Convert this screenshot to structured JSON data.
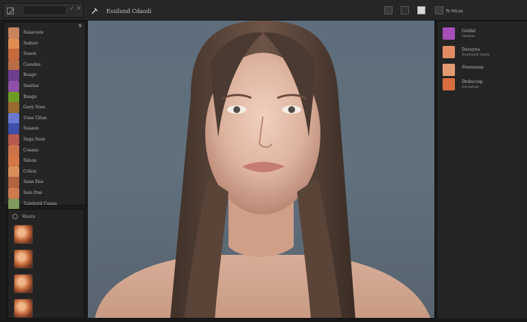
{
  "window": {
    "title": "Essilund Cdaodi"
  },
  "topbar": {
    "app_icon": "wrench-icon",
    "check_icon": "check-icon",
    "close_icon": "close-icon",
    "tool_icon": "hammer-icon",
    "right_label": "fb Ntcas",
    "buttons": [
      "camera-icon",
      "layout-icon",
      "render-icon",
      "settings-icon"
    ]
  },
  "left_panel": {
    "count": "9",
    "items": [
      {
        "label": "Saaacoon",
        "color": "#c9845d"
      },
      {
        "label": "Soduvr",
        "color": "#dd8d50"
      },
      {
        "label": "Suacn",
        "color": "#c66a3d"
      },
      {
        "label": "Csosdos",
        "color": "#bb6d45"
      },
      {
        "label": "Buagv",
        "color": "#6e3d90"
      },
      {
        "label": "Sanitas",
        "color": "#8f4ea8"
      },
      {
        "label": "Buagn",
        "color": "#6e9b25"
      },
      {
        "label": "Gaoy Sosa",
        "color": "#9a6a2f"
      },
      {
        "label": "Usne Citan",
        "color": "#6a7ad0"
      },
      {
        "label": "Saaaon",
        "color": "#3e4ea9"
      },
      {
        "label": "Saga Sosn",
        "color": "#b85a4d"
      },
      {
        "label": "Cosano",
        "color": "#cc7248"
      },
      {
        "label": "Siman",
        "color": "#d57645"
      },
      {
        "label": "Cvlicn",
        "color": "#d98f5a"
      },
      {
        "label": "Sann Ena",
        "color": "#b06440"
      },
      {
        "label": "Sain Itna",
        "color": "#d07b4f"
      },
      {
        "label": "Tuinhntd Cuana",
        "color": "#7f9a5a"
      }
    ]
  },
  "left_lower": {
    "title": "Wantu",
    "swatches": 4
  },
  "right_panel": {
    "items": [
      {
        "label": "Goldid",
        "sublabel": "Gtzbsio",
        "color": "#a64fb7"
      },
      {
        "label": "Dasuyna",
        "sublabel": "Saubnatd Sindu",
        "color": "#e08b63"
      },
      {
        "label": "Stoeunesa",
        "sublabel": "",
        "color": "#e49a71"
      },
      {
        "label": "Dndaccnp",
        "sublabel": "Sucsaluat",
        "color": "#d86e3f"
      }
    ]
  },
  "viewport": {
    "background": "#5e6e7c",
    "subject": "portrait-render"
  }
}
